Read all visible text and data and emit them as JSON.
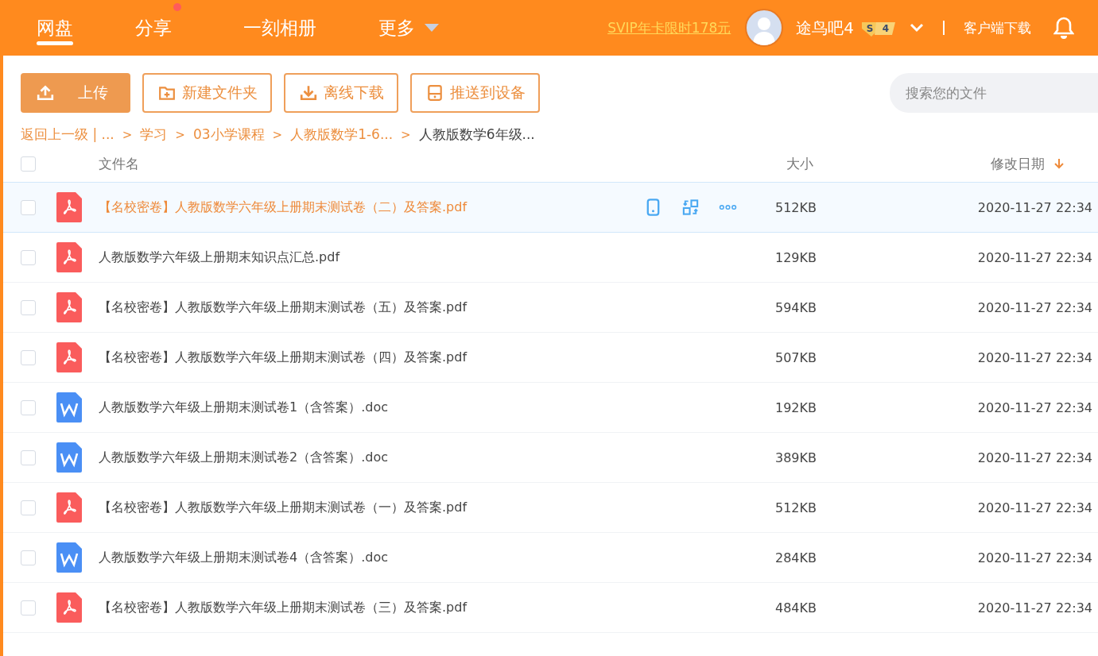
{
  "nav": {
    "tabs": [
      {
        "label": "网盘",
        "selected": true,
        "badge": false,
        "dropdown": false
      },
      {
        "label": "分享",
        "selected": false,
        "badge": true,
        "dropdown": false
      },
      {
        "label": "一刻相册",
        "selected": false,
        "badge": false,
        "dropdown": false
      },
      {
        "label": "更多",
        "selected": false,
        "badge": false,
        "dropdown": true
      }
    ],
    "promo": "SVIP年卡限时178元",
    "user": "途鸟吧4",
    "level_badge": {
      "tier": "S",
      "level": "4"
    },
    "client_download": "客户端下载"
  },
  "toolbar": {
    "buttons": [
      {
        "label": "上传",
        "kind": "primary"
      },
      {
        "label": "新建文件夹",
        "kind": "outline"
      },
      {
        "label": "离线下载",
        "kind": "outline"
      },
      {
        "label": "推送到设备",
        "kind": "outline"
      }
    ],
    "search": {
      "placeholder": "搜索您的文件"
    }
  },
  "breadcrumb": [
    {
      "label": "返回上一级 | ...",
      "kind": "link"
    },
    {
      "separator": ">",
      "label": "学习",
      "kind": "link"
    },
    {
      "separator": ">",
      "label": "03小学课程",
      "kind": "link"
    },
    {
      "separator": ">",
      "label": "人教版数学1-6...",
      "kind": "link"
    },
    {
      "separator": ">",
      "label": "人教版数学6年级...",
      "kind": "current"
    }
  ],
  "table": {
    "all_checked": false,
    "columns": [
      {
        "label": "文件名",
        "sorted": false
      },
      {
        "label": "大小",
        "sorted": false
      },
      {
        "label": "修改日期",
        "sorted": true
      }
    ],
    "rows": [
      {
        "name": "【名校密卷】人教版数学六年级上册期末测试卷（二）及答案.pdf",
        "kind": "pdf",
        "size": "512KB",
        "date": "2020-11-27 22:34",
        "selected": true,
        "checked": false
      },
      {
        "name": "人教版数学六年级上册期末知识点汇总.pdf",
        "kind": "pdf",
        "size": "129KB",
        "date": "2020-11-27 22:34",
        "selected": false,
        "checked": false
      },
      {
        "name": "【名校密卷】人教版数学六年级上册期末测试卷（五）及答案.pdf",
        "kind": "pdf",
        "size": "594KB",
        "date": "2020-11-27 22:34",
        "selected": false,
        "checked": false
      },
      {
        "name": "【名校密卷】人教版数学六年级上册期末测试卷（四）及答案.pdf",
        "kind": "pdf",
        "size": "507KB",
        "date": "2020-11-27 22:34",
        "selected": false,
        "checked": false
      },
      {
        "name": "人教版数学六年级上册期末测试卷1（含答案）.doc",
        "kind": "doc",
        "size": "192KB",
        "date": "2020-11-27 22:34",
        "selected": false,
        "checked": false
      },
      {
        "name": "人教版数学六年级上册期末测试卷2（含答案）.doc",
        "kind": "doc",
        "size": "389KB",
        "date": "2020-11-27 22:34",
        "selected": false,
        "checked": false
      },
      {
        "name": "【名校密卷】人教版数学六年级上册期末测试卷（一）及答案.pdf",
        "kind": "pdf",
        "size": "512KB",
        "date": "2020-11-27 22:34",
        "selected": false,
        "checked": false
      },
      {
        "name": "人教版数学六年级上册期末测试卷4（含答案）.doc",
        "kind": "doc",
        "size": "284KB",
        "date": "2020-11-27 22:34",
        "selected": false,
        "checked": false
      },
      {
        "name": "【名校密卷】人教版数学六年级上册期末测试卷（三）及答案.pdf",
        "kind": "pdf",
        "size": "484KB",
        "date": "2020-11-27 22:34",
        "selected": false,
        "checked": false
      }
    ]
  }
}
